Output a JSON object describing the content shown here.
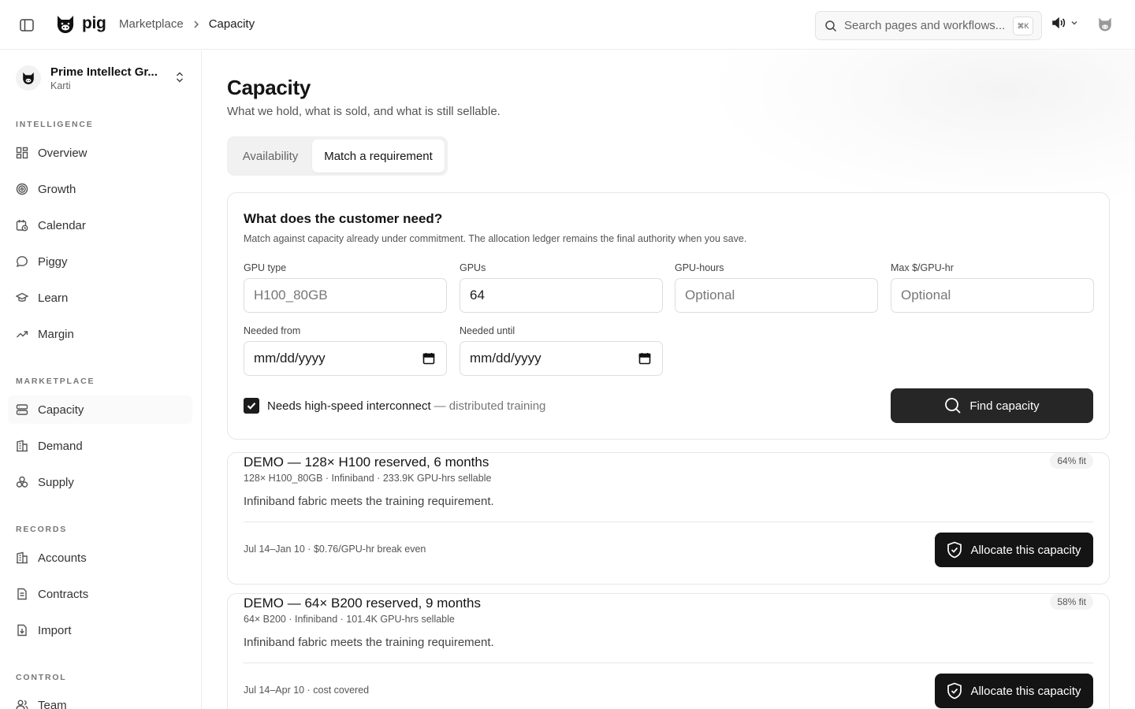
{
  "topbar": {
    "brand": "pig",
    "breadcrumb": [
      "Marketplace",
      "Capacity"
    ],
    "search_placeholder": "Search pages and workflows...",
    "search_shortcut": "⌘K"
  },
  "sidebar": {
    "org_name": "Prime Intellect Gr...",
    "org_user": "Karti",
    "sections": [
      {
        "label": "INTELLIGENCE",
        "items": [
          {
            "label": "Overview",
            "icon": "dashboard-icon"
          },
          {
            "label": "Growth",
            "icon": "target-icon"
          },
          {
            "label": "Calendar",
            "icon": "calendar-clock-icon"
          },
          {
            "label": "Piggy",
            "icon": "chat-bubble-icon"
          },
          {
            "label": "Learn",
            "icon": "graduation-cap-icon"
          },
          {
            "label": "Margin",
            "icon": "trending-up-icon"
          }
        ]
      },
      {
        "label": "MARKETPLACE",
        "items": [
          {
            "label": "Capacity",
            "icon": "server-icon",
            "active": true
          },
          {
            "label": "Demand",
            "icon": "building-icon"
          },
          {
            "label": "Supply",
            "icon": "boxes-icon"
          }
        ]
      },
      {
        "label": "RECORDS",
        "items": [
          {
            "label": "Accounts",
            "icon": "building-icon"
          },
          {
            "label": "Contracts",
            "icon": "document-icon"
          },
          {
            "label": "Import",
            "icon": "import-icon"
          }
        ]
      },
      {
        "label": "CONTROL",
        "items": [
          {
            "label": "Team",
            "icon": "users-icon"
          }
        ]
      }
    ]
  },
  "main": {
    "title": "Capacity",
    "subtitle": "What we hold, what is sold, and what is still sellable.",
    "tabs": [
      {
        "label": "Availability",
        "active": false
      },
      {
        "label": "Match a requirement",
        "active": true
      }
    ],
    "form": {
      "title": "What does the customer need?",
      "description": "Match against capacity already under commitment. The allocation ledger remains the final authority when you save.",
      "gpu_type_label": "GPU type",
      "gpu_type_placeholder": "H100_80GB",
      "gpus_label": "GPUs",
      "gpus_value": "64",
      "gpu_hours_label": "GPU-hours",
      "gpu_hours_placeholder": "Optional",
      "max_price_label": "Max $/GPU-hr",
      "max_price_placeholder": "Optional",
      "needed_from_label": "Needed from",
      "needed_from_value": "mm/dd/yyyy",
      "needed_until_label": "Needed until",
      "needed_until_value": "mm/dd/yyyy",
      "interconnect_label": "Needs high-speed interconnect",
      "interconnect_suffix": "— distributed training",
      "interconnect_checked": true,
      "find_button": "Find capacity"
    },
    "results": [
      {
        "title": "DEMO — 128× H100 reserved, 6 months",
        "meta": "128× H100_80GB · Infiniband · 233.9K GPU-hrs sellable",
        "fit": "64% fit",
        "note": "Infiniband fabric meets the training requirement.",
        "footer": "Jul 14–Jan 10 · $0.76/GPU-hr break even",
        "button": "Allocate this capacity"
      },
      {
        "title": "DEMO — 64× B200 reserved, 9 months",
        "meta": "64× B200 · Infiniband · 101.4K GPU-hrs sellable",
        "fit": "58% fit",
        "note": "Infiniband fabric meets the training requirement.",
        "footer": "Jul 14–Apr 10 · cost covered",
        "button": "Allocate this capacity"
      }
    ]
  }
}
